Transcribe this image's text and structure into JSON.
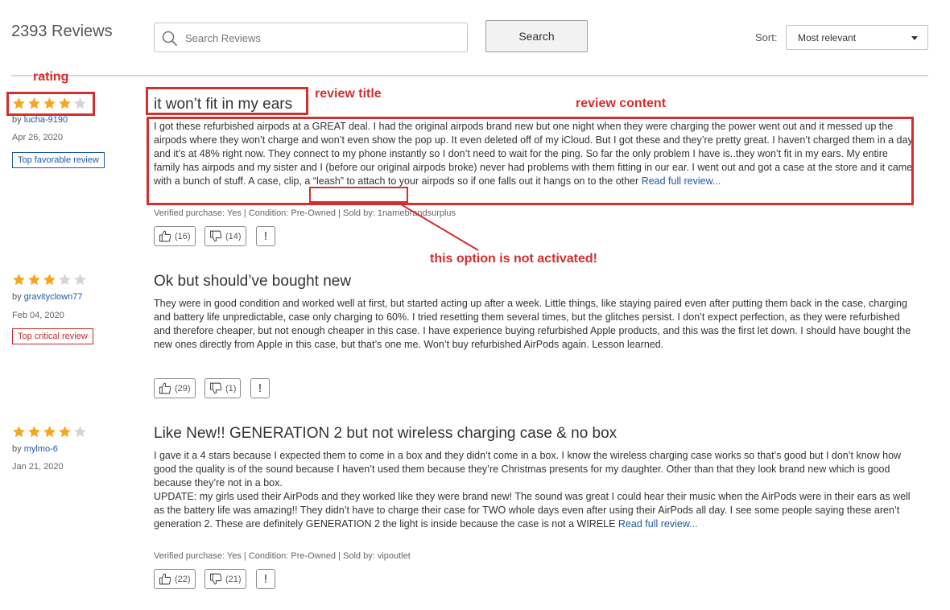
{
  "header": {
    "review_count": "2393 Reviews",
    "search_placeholder": "Search Reviews",
    "search_button": "Search",
    "sort_label": "Sort:",
    "sort_value": "Most relevant"
  },
  "colors": {
    "star_filled": "#f5a623",
    "star_empty": "#d6d6d6",
    "link": "#1f58a8",
    "annotation": "#d32f2f"
  },
  "reviews": [
    {
      "rating": 4,
      "by": "by ",
      "user": "lucha-9190",
      "date": "Apr 26, 2020",
      "badge": "Top favorable review",
      "title": "it won’t fit in my ears",
      "body": "I got these refurbished airpods at a GREAT deal. I had the original airpods brand new but one night when they were charging the power went out and it messed up the airpods where they won’t charge and won’t even show the pop up. It even deleted off of my iCloud. But I got these and they’re pretty great. I haven’t charged them in a day and it’s at 48% right now. They connect to my phone instantly so I don’t need to wait for the ping. So far the only problem I have is..they won’t fit in my ears. My entire family has airpods and my sister and I (before our original airpods broke) never had problems with them fitting in our ear. I went out and got a case at the store and it came with a bunch of stuff. A case, clip, a “leash” to attach to your airpods so if one falls out it hangs on to the other ",
      "read_more": "Read full review...",
      "meta": "Verified purchase:  Yes | Condition: Pre-Owned | Sold by:  1namebrandsurplus",
      "helpful": "(16)",
      "unhelpful": "(14)",
      "report": "!"
    },
    {
      "rating": 3,
      "by": "by ",
      "user": "gravityclown77",
      "date": "Feb 04, 2020",
      "badge": "Top critical review",
      "title": "Ok but should’ve bought new",
      "body": "They were in good condition and worked well at first, but started acting up after a week. Little things, like staying paired even after putting them back in the case, charging and battery life unpredictable, case only charging to 60%. I tried resetting them several times, but the glitches persist. I don’t expect perfection, as they were refurbished and therefore cheaper, but not enough cheaper in this case. I have experience buying refurbished Apple products, and this was the first let down.  I should have bought the new ones directly from Apple in this case, but that’s one me. Won’t buy refurbished AirPods again. Lesson learned.",
      "helpful": "(29)",
      "unhelpful": "(1)",
      "report": "!"
    },
    {
      "rating": 4,
      "by": "by ",
      "user": "mylmo-6",
      "date": "Jan 21, 2020",
      "title": "Like New!! GENERATION 2 but not wireless charging case & no box",
      "body": "I gave it a 4 stars because I expected them to come in a box and they didn’t come in a box. I know the wireless charging case works so that’s good but I don’t know how good the quality is of the sound because I haven’t used them because they’re Christmas presents for my daughter. Other than that they look brand new which is good because they’re not in a box.",
      "body2": "UPDATE: my girls used their AirPods and they worked like they were brand new! The sound was great I could hear their music when the AirPods were in their ears as well as the battery life was amazing!! They didn’t have to charge their case for TWO whole days even after using their AirPods all day. I see some people saying these aren’t generation 2. These are definitely GENERATION 2 the light is inside because the case is not a WIRELE ",
      "read_more": "Read full review...",
      "meta": "Verified purchase:  Yes | Condition: Pre-Owned | Sold by: vipoutlet",
      "helpful": "(22)",
      "unhelpful": "(21)",
      "report": "!"
    }
  ],
  "annotations": {
    "rating": "rating",
    "review_title": "review title",
    "review_content": "review content",
    "not_activated": "this option is not activated!"
  }
}
